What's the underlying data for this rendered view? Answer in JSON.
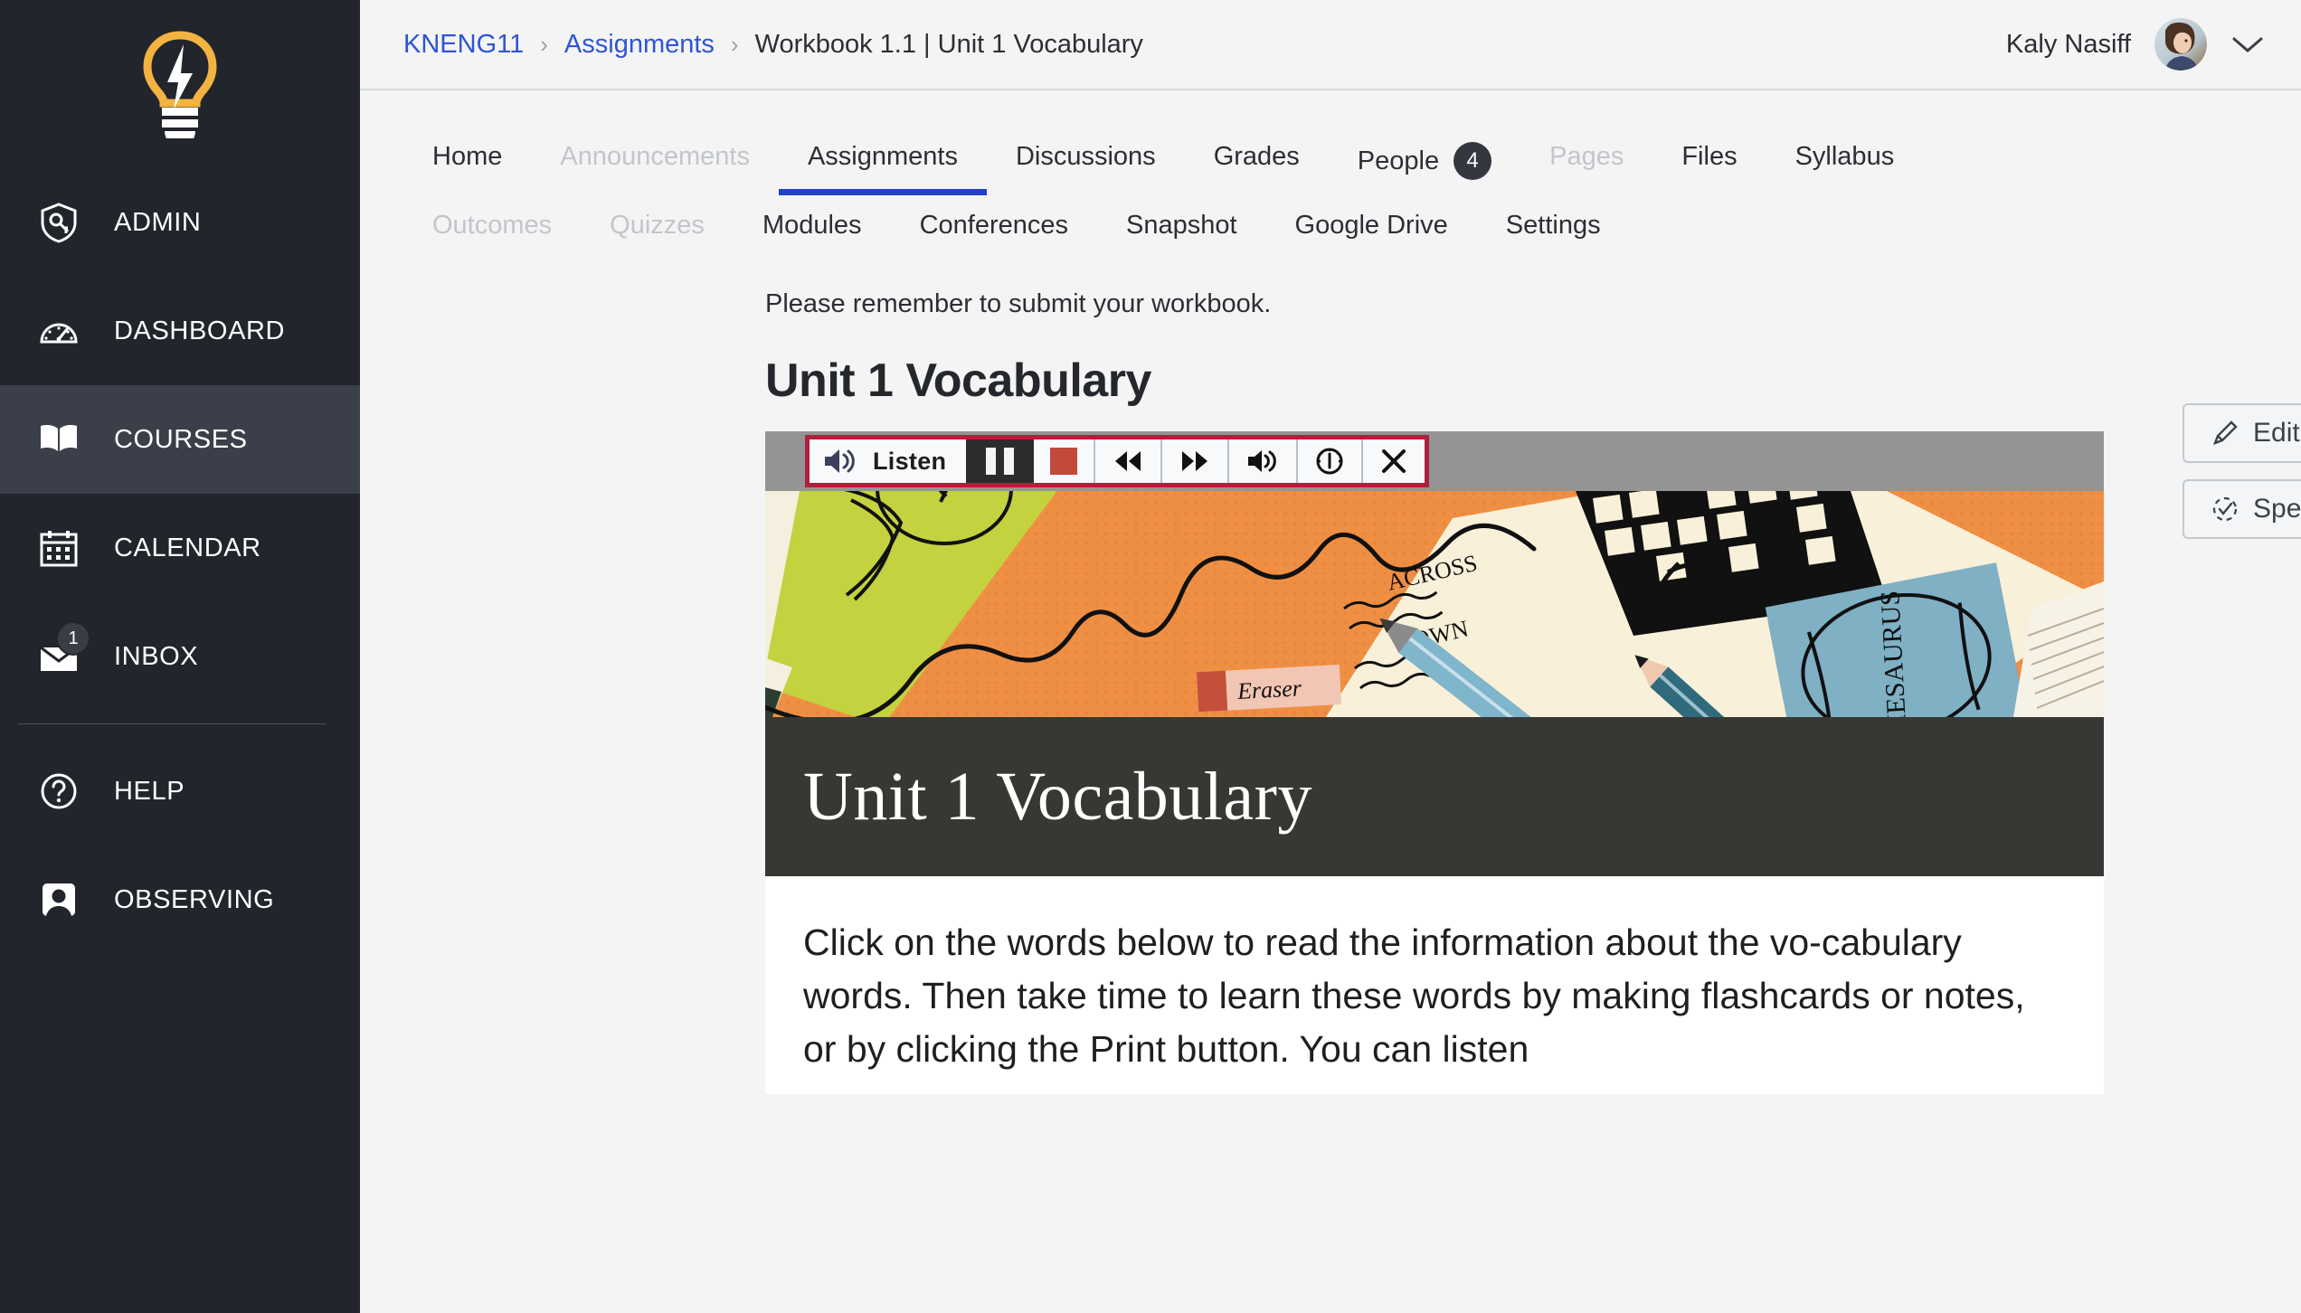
{
  "sidebar": {
    "logo_icon": "lightbulb-bolt-logo",
    "items": [
      {
        "label": "ADMIN",
        "icon": "shield-key-icon",
        "active": false,
        "badge": null
      },
      {
        "label": "DASHBOARD",
        "icon": "speedometer-icon",
        "active": false,
        "badge": null
      },
      {
        "label": "COURSES",
        "icon": "open-book-icon",
        "active": true,
        "badge": null
      },
      {
        "label": "CALENDAR",
        "icon": "calendar-icon",
        "active": false,
        "badge": null
      },
      {
        "label": "INBOX",
        "icon": "envelope-icon",
        "active": false,
        "badge": "1"
      },
      {
        "label": "HELP",
        "icon": "question-circle-icon",
        "active": false,
        "badge": null
      },
      {
        "label": "OBSERVING",
        "icon": "user-portrait-icon",
        "active": false,
        "badge": null
      }
    ],
    "collapse_icon": "chevron-left-icon"
  },
  "topbar": {
    "breadcrumb": {
      "course": "KNENG11",
      "section": "Assignments",
      "current": "Workbook 1.1 | Unit 1 Vocabulary",
      "separator": "›"
    },
    "user": {
      "name": "Kaly Nasiff",
      "avatar_icon": "user-avatar",
      "menu_icon": "chevron-down-icon"
    }
  },
  "course_nav": {
    "row1": [
      {
        "label": "Home",
        "state": "normal"
      },
      {
        "label": "Announcements",
        "state": "disabled"
      },
      {
        "label": "Assignments",
        "state": "active"
      },
      {
        "label": "Discussions",
        "state": "normal"
      },
      {
        "label": "Grades",
        "state": "normal"
      },
      {
        "label": "People",
        "state": "normal",
        "badge": "4"
      },
      {
        "label": "Pages",
        "state": "disabled"
      },
      {
        "label": "Files",
        "state": "normal"
      },
      {
        "label": "Syllabus",
        "state": "normal"
      }
    ],
    "row2": [
      {
        "label": "Outcomes",
        "state": "disabled"
      },
      {
        "label": "Quizzes",
        "state": "disabled"
      },
      {
        "label": "Modules",
        "state": "normal"
      },
      {
        "label": "Conferences",
        "state": "normal"
      },
      {
        "label": "Snapshot",
        "state": "normal"
      },
      {
        "label": "Google Drive",
        "state": "normal"
      },
      {
        "label": "Settings",
        "state": "normal"
      }
    ]
  },
  "content": {
    "intro_note": "Please remember to submit your workbook.",
    "assignment_title": "Unit 1 Vocabulary"
  },
  "listen_toolbar": {
    "speaker_icon": "speaker-volume-icon",
    "listen_label": "Listen",
    "buttons": [
      {
        "icon": "pause-icon",
        "name": "pause-button"
      },
      {
        "icon": "stop-square-icon",
        "name": "stop-button"
      },
      {
        "icon": "rewind-icon",
        "name": "rewind-button"
      },
      {
        "icon": "fast-forward-icon",
        "name": "forward-button"
      },
      {
        "icon": "volume-icon",
        "name": "volume-button"
      },
      {
        "icon": "speedometer-icon",
        "name": "speed-button"
      },
      {
        "icon": "close-x-icon",
        "name": "close-button"
      }
    ],
    "border_color": "#b0203c",
    "stop_color": "#c24a3c"
  },
  "document": {
    "hero_illustration": "crossword-pencils-thesaurus-illustration",
    "hero_labels": {
      "across": "ACROSS",
      "down": "DOWN",
      "eraser": "Eraser",
      "thesaurus": "THESAURUS"
    },
    "banner_title": "Unit 1 Vocabulary",
    "body_text": "Click on the words below to read the information about the vo-cabulary words. Then take time to learn these words by making flashcards or notes, or by clicking the Print button. You can listen"
  },
  "right_rail": {
    "buttons": [
      {
        "label": "Edit Assignment Settings",
        "icon": "pencil-icon",
        "name": "edit-assignment-settings-button"
      },
      {
        "label": "Speed Grader™",
        "icon": "check-circle-dashed-icon",
        "name": "speed-grader-button"
      }
    ]
  },
  "colors": {
    "sidebar_bg": "#22252b",
    "sidebar_active": "#3b3f49",
    "logo_accent": "#f3b340",
    "link_blue": "#2f55d4",
    "tab_active_underline": "#2440c8",
    "banner_dark": "#383733",
    "hero_orange": "#ef8f44",
    "hero_green": "#c3d23e",
    "hero_blue": "#7fb0c4"
  }
}
